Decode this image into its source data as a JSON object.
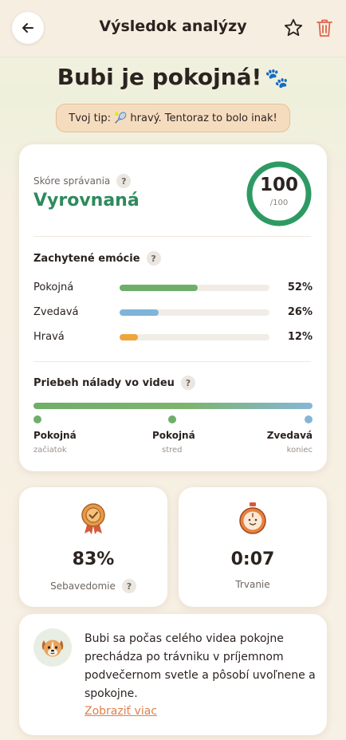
{
  "header": {
    "title": "Výsledok analýzy"
  },
  "hero": {
    "title": "Bubi je pokojná!",
    "paw": "🐾",
    "tip": "Tvoj tip: 🎾 hravý. Tentoraz to bolo inak!"
  },
  "score": {
    "label": "Skóre správania",
    "value": "Vyrovnaná",
    "points": "100",
    "max": "/100",
    "help": "?"
  },
  "emotions": {
    "title": "Zachytené emócie",
    "help": "?",
    "items": [
      {
        "label": "Pokojná",
        "percent": "52%",
        "value": 52,
        "color": "#6fae6a"
      },
      {
        "label": "Zvedavá",
        "percent": "26%",
        "value": 26,
        "color": "#7fb5d8"
      },
      {
        "label": "Hravá",
        "percent": "12%",
        "value": 12,
        "color": "#f0a53a"
      }
    ]
  },
  "mood": {
    "title": "Priebeh nálady vo videu",
    "help": "?",
    "points": [
      {
        "label": "Pokojná",
        "sub": "začiatok",
        "color": "#6fae6a"
      },
      {
        "label": "Pokojná",
        "sub": "stred",
        "color": "#6fae6a"
      },
      {
        "label": "Zvedavá",
        "sub": "koniec",
        "color": "#86b6d6"
      }
    ]
  },
  "stats": {
    "confidence": {
      "value": "83%",
      "label": "Sebavedomie",
      "help": "?",
      "icon": "medal-icon"
    },
    "duration": {
      "value": "0:07",
      "label": "Trvanie",
      "icon": "stopwatch-icon"
    }
  },
  "summary": {
    "text": "Bubi sa počas celého videa pokojne prechádza po trávniku v príjemnom podvečernom svetle a pôsobí uvoľnene a spokojne.",
    "more": "Zobraziť viac",
    "avatar_icon": "dog-icon"
  },
  "colors": {
    "accent_green": "#2e8a5c",
    "link_orange": "#e07f4a",
    "delete_red": "#e0644e"
  }
}
